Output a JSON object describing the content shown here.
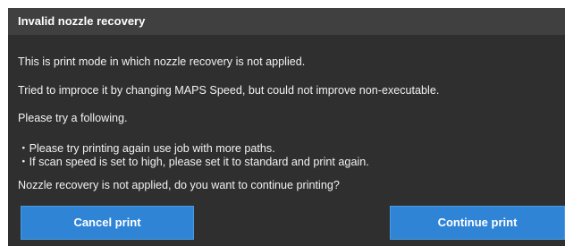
{
  "dialog": {
    "title": "Invalid nozzle recovery",
    "lines": [
      "This is print mode in which nozzle recovery is not applied.",
      "Tried to improce it by changing MAPS Speed, but could not improve non-executable.",
      "Please try a following.",
      "・Please try printing again use job with more paths.",
      "・If scan speed is set to high, please set it to standard and print again.",
      "Nozzle recovery is not applied, do you want to continue printing?"
    ],
    "cancel_label": "Cancel print",
    "continue_label": "Continue print"
  },
  "colors": {
    "dialog_background": "#2f2f2f",
    "titlebar_background": "#404040",
    "button_blue": "#2f84d6"
  }
}
